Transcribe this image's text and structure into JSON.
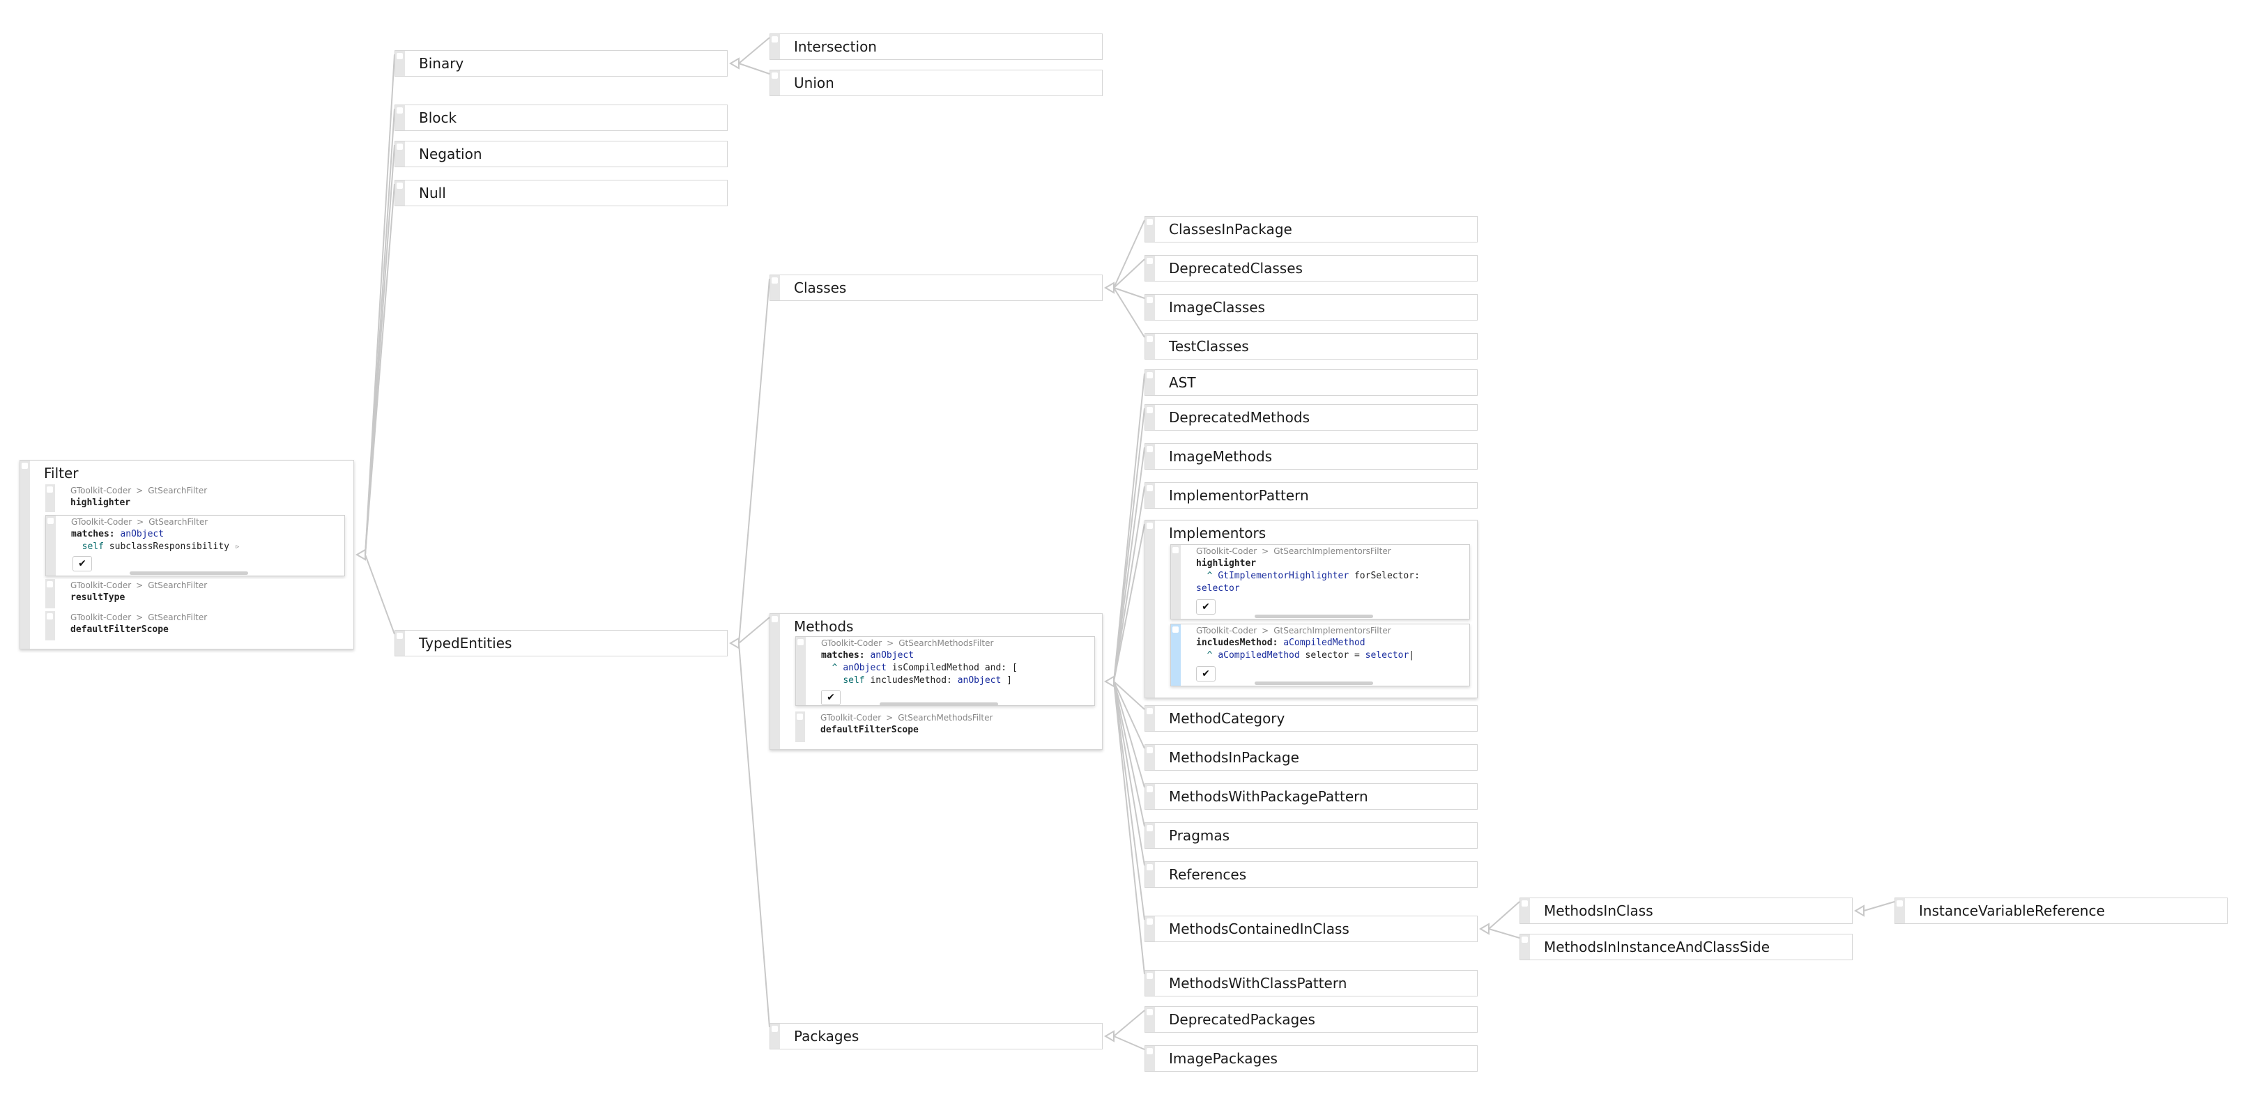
{
  "colors": {
    "edge": "#c8c8c8",
    "node_border": "#d6d6d6",
    "handle": "#e6e6e6",
    "active_handle": "#bfe0fb",
    "variable": "#1a2d9e"
  },
  "nodes": {
    "filter": {
      "title": "Filter",
      "methods": [
        {
          "crumb_pkg": "GToolkit-Coder",
          "crumb_sep": ">",
          "crumb_class": "GtSearchFilter",
          "selector": "highlighter"
        },
        {
          "crumb_pkg": "GToolkit-Coder",
          "crumb_sep": ">",
          "crumb_class": "GtSearchFilter",
          "sel_kw": "matches:",
          "arg": "anObject",
          "line2_self": "self",
          "line2_rest": "subclassResponsibility",
          "accept": "✔"
        },
        {
          "crumb_pkg": "GToolkit-Coder",
          "crumb_sep": ">",
          "crumb_class": "GtSearchFilter",
          "selector": "resultType"
        },
        {
          "crumb_pkg": "GToolkit-Coder",
          "crumb_sep": ">",
          "crumb_class": "GtSearchFilter",
          "selector": "defaultFilterScope"
        }
      ]
    },
    "binary": "Binary",
    "block": "Block",
    "negation": "Negation",
    "null": "Null",
    "typed_entities": "TypedEntities",
    "intersection": "Intersection",
    "union": "Union",
    "classes": "Classes",
    "methods": {
      "title": "Methods",
      "methods": [
        {
          "crumb_pkg": "GToolkit-Coder",
          "crumb_sep": ">",
          "crumb_class": "GtSearchMethodsFilter",
          "sel_kw": "matches:",
          "arg": "anObject",
          "l2_caret": "^",
          "l2_var": "anObject",
          "l2_rest": "isCompiledMethod and: [",
          "l3_self": "self",
          "l3_msg": "includesMethod:",
          "l3_var": "anObject",
          "l3_close": "]",
          "accept": "✔"
        },
        {
          "crumb_pkg": "GToolkit-Coder",
          "crumb_sep": ">",
          "crumb_class": "GtSearchMethodsFilter",
          "selector": "defaultFilterScope"
        }
      ]
    },
    "packages": "Packages",
    "classes_children": [
      "ClassesInPackage",
      "DeprecatedClasses",
      "ImageClasses",
      "TestClasses"
    ],
    "method_children": [
      "AST",
      "DeprecatedMethods",
      "ImageMethods",
      "ImplementorPattern"
    ],
    "implementors": {
      "title": "Implementors",
      "methods": [
        {
          "crumb_pkg": "GToolkit-Coder",
          "crumb_sep": ">",
          "crumb_class": "GtSearchImplementorsFilter",
          "selector": "highlighter",
          "l2_caret": "^",
          "l2_class": "GtImplementorHighlighter",
          "l2_msg": "forSelector:",
          "l3_var": "selector",
          "accept": "✔"
        },
        {
          "crumb_pkg": "GToolkit-Coder",
          "crumb_sep": ">",
          "crumb_class": "GtSearchImplementorsFilter",
          "sel_kw": "includesMethod:",
          "arg": "aCompiledMethod",
          "l2_caret": "^",
          "l2_var": "aCompiledMethod",
          "l2_msg": "selector =",
          "l2_var2": "selector",
          "accept": "✔"
        }
      ]
    },
    "method_children_2": [
      "MethodCategory",
      "MethodsInPackage",
      "MethodsWithPackagePattern",
      "Pragmas",
      "References",
      "MethodsContainedInClass",
      "MethodsWithClassPattern"
    ],
    "methods_contained_children": [
      "MethodsInClass",
      "MethodsInInstanceAndClassSide"
    ],
    "instance_variable_reference": "InstanceVariableReference",
    "package_children": [
      "DeprecatedPackages",
      "ImagePackages"
    ]
  }
}
